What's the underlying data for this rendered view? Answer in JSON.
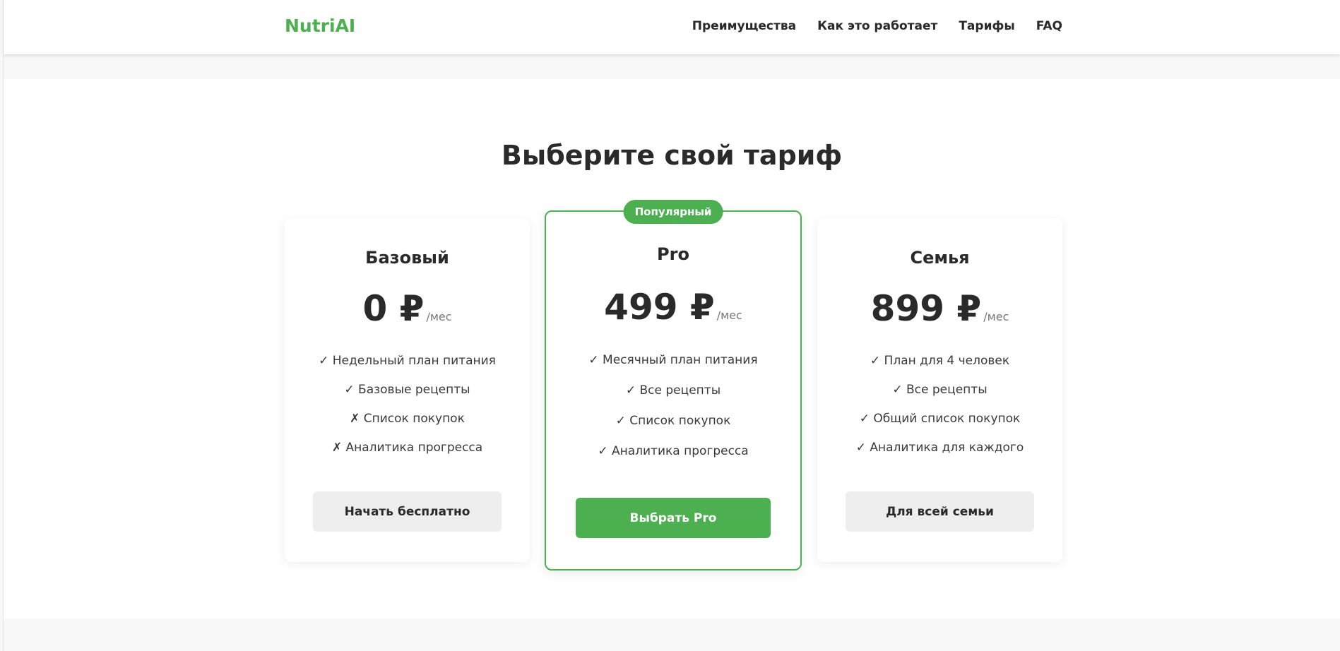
{
  "header": {
    "logo": "NutriAI",
    "nav": [
      "Преимущества",
      "Как это работает",
      "Тарифы",
      "FAQ"
    ]
  },
  "pricing": {
    "title": "Выберите свой тариф",
    "plans": [
      {
        "name": "Базовый",
        "price": "0 ₽",
        "period": "/мес",
        "features": [
          "✓ Недельный план питания",
          "✓ Базовые рецепты",
          "✗ Список покупок",
          "✗ Аналитика прогресса"
        ],
        "button": "Начать бесплатно"
      },
      {
        "name": "Pro",
        "badge": "Популярный",
        "price": "499 ₽",
        "period": "/мес",
        "features": [
          "✓ Месячный план питания",
          "✓ Все рецепты",
          "✓ Список покупок",
          "✓ Аналитика прогресса"
        ],
        "button": "Выбрать Pro"
      },
      {
        "name": "Семья",
        "price": "899 ₽",
        "period": "/мес",
        "features": [
          "✓ План для 4 человек",
          "✓ Все рецепты",
          "✓ Общий список покупок",
          "✓ Аналитика для каждого"
        ],
        "button": "Для всей семьи"
      }
    ]
  },
  "colors": {
    "accent": "#4caf50",
    "text": "#2a2a2a",
    "muted": "#777777",
    "button_secondary": "#eeeeee",
    "page_background": "#f8f8f8"
  }
}
